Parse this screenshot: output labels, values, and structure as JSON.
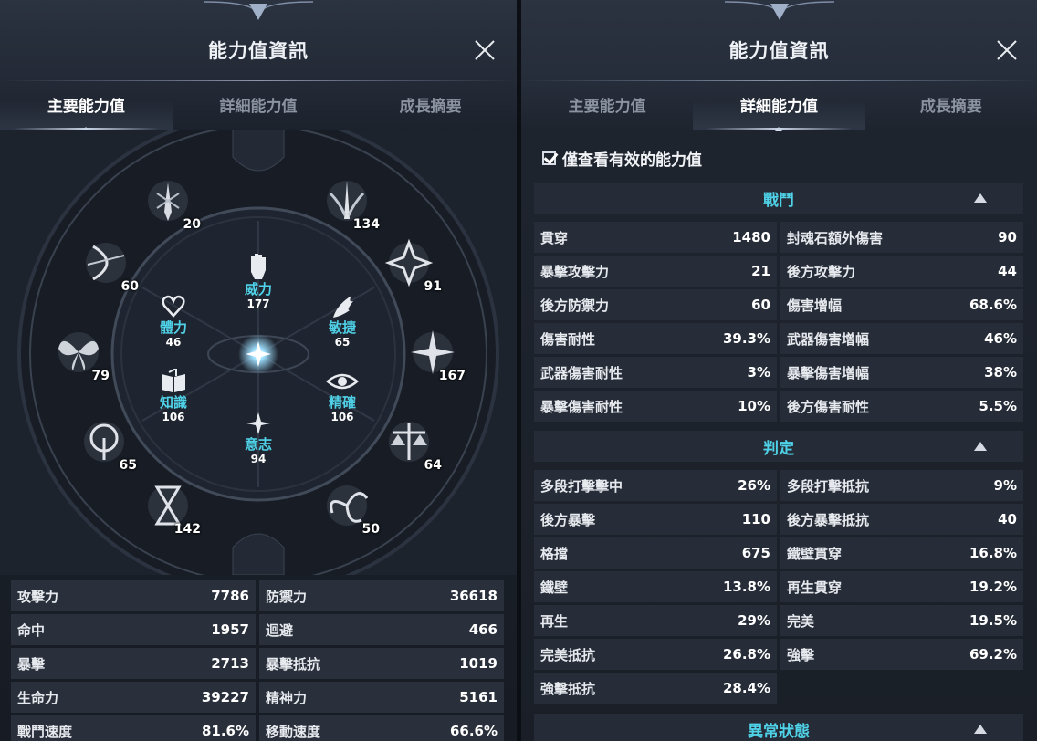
{
  "left_panel": {
    "title": "能力值資訊",
    "tabs": [
      "主要能力值",
      "詳細能力值",
      "成長摘要"
    ],
    "active_tab": 0,
    "stats": {
      "power": {
        "label": "威力",
        "value": "177"
      },
      "vitality": {
        "label": "體力",
        "value": "46"
      },
      "agility": {
        "label": "敏捷",
        "value": "65"
      },
      "knowledge": {
        "label": "知識",
        "value": "106"
      },
      "precision": {
        "label": "精確",
        "value": "106"
      },
      "will": {
        "label": "意志",
        "value": "94"
      }
    },
    "engravings": [
      "20",
      "134",
      "60",
      "91",
      "79",
      "167",
      "65",
      "64",
      "142",
      "50"
    ],
    "basic_stats": [
      [
        {
          "k": "攻擊力",
          "v": "7786"
        },
        {
          "k": "防禦力",
          "v": "36618"
        }
      ],
      [
        {
          "k": "命中",
          "v": "1957"
        },
        {
          "k": "迴避",
          "v": "466"
        }
      ],
      [
        {
          "k": "暴擊",
          "v": "2713"
        },
        {
          "k": "暴擊抵抗",
          "v": "1019"
        }
      ],
      [
        {
          "k": "生命力",
          "v": "39227"
        },
        {
          "k": "精神力",
          "v": "5161"
        }
      ],
      [
        {
          "k": "戰鬥速度",
          "v": "81.6%"
        },
        {
          "k": "移動速度",
          "v": "66.6%"
        }
      ]
    ]
  },
  "right_panel": {
    "title": "能力值資訊",
    "tabs": [
      "主要能力值",
      "詳細能力值",
      "成長摘要"
    ],
    "active_tab": 1,
    "only_valid_label": "僅查看有效的能力值",
    "only_valid_checked": true,
    "sections": {
      "combat": {
        "title": "戰鬥",
        "rows": [
          [
            {
              "k": "貫穿",
              "v": "1480"
            },
            {
              "k": "封魂石額外傷害",
              "v": "90"
            }
          ],
          [
            {
              "k": "暴擊攻擊力",
              "v": "21"
            },
            {
              "k": "後方攻擊力",
              "v": "44"
            }
          ],
          [
            {
              "k": "後方防禦力",
              "v": "60"
            },
            {
              "k": "傷害增幅",
              "v": "68.6%"
            }
          ],
          [
            {
              "k": "傷害耐性",
              "v": "39.3%"
            },
            {
              "k": "武器傷害增幅",
              "v": "46%"
            }
          ],
          [
            {
              "k": "武器傷害耐性",
              "v": "3%"
            },
            {
              "k": "暴擊傷害增幅",
              "v": "38%"
            }
          ],
          [
            {
              "k": "暴擊傷害耐性",
              "v": "10%"
            },
            {
              "k": "後方傷害耐性",
              "v": "5.5%"
            }
          ]
        ]
      },
      "judgement": {
        "title": "判定",
        "rows": [
          [
            {
              "k": "多段打擊擊中",
              "v": "26%"
            },
            {
              "k": "多段打擊抵抗",
              "v": "9%"
            }
          ],
          [
            {
              "k": "後方暴擊",
              "v": "110"
            },
            {
              "k": "後方暴擊抵抗",
              "v": "40"
            }
          ],
          [
            {
              "k": "格擋",
              "v": "675"
            },
            {
              "k": "鐵壁貫穿",
              "v": "16.8%"
            }
          ],
          [
            {
              "k": "鐵壁",
              "v": "13.8%"
            },
            {
              "k": "再生貫穿",
              "v": "19.2%"
            }
          ],
          [
            {
              "k": "再生",
              "v": "29%"
            },
            {
              "k": "完美",
              "v": "19.5%"
            }
          ],
          [
            {
              "k": "完美抵抗",
              "v": "26.8%"
            },
            {
              "k": "強擊",
              "v": "69.2%"
            }
          ],
          [
            {
              "k": "強擊抵抗",
              "v": "28.4%"
            },
            {
              "k": "",
              "v": ""
            }
          ]
        ]
      },
      "abnormal": {
        "title": "異常狀態"
      }
    }
  },
  "colors": {
    "accent_cyan": "#4fd2e8",
    "cell_bg": "#2a303b",
    "panel_bg": "#1c222c"
  }
}
